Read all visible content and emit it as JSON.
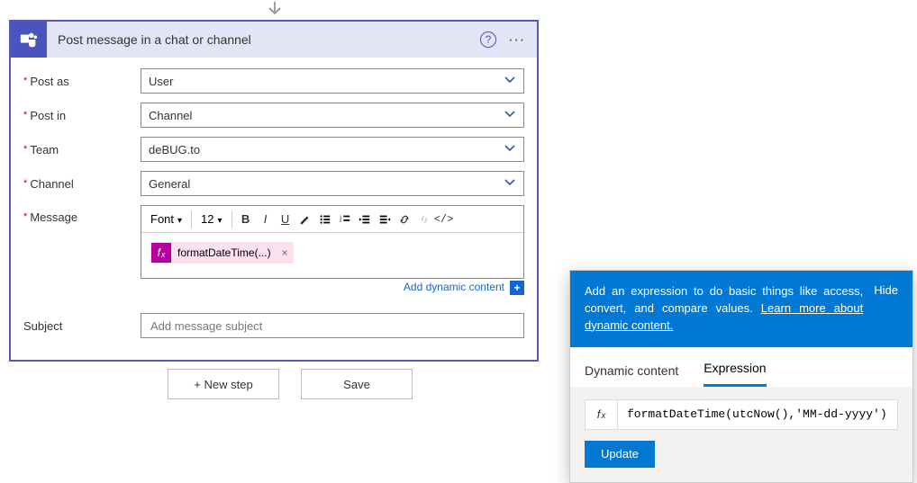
{
  "card": {
    "title": "Post message in a chat or channel",
    "fields": {
      "post_as": {
        "label": "Post as",
        "value": "User"
      },
      "post_in": {
        "label": "Post in",
        "value": "Channel"
      },
      "team": {
        "label": "Team",
        "value": "deBUG.to"
      },
      "channel": {
        "label": "Channel",
        "value": "General"
      },
      "message": {
        "label": "Message"
      },
      "subject": {
        "label": "Subject",
        "placeholder": "Add message subject"
      }
    },
    "toolbar": {
      "font_label": "Font",
      "size_label": "12"
    },
    "token": {
      "text": "formatDateTime(...)"
    },
    "add_dynamic_label": "Add dynamic content"
  },
  "footer": {
    "new_step": "+ New step",
    "save": "Save"
  },
  "panel": {
    "tip": "Add an expression to do basic things like access, convert, and compare values. ",
    "learn_more": "Learn more about dynamic content.",
    "hide": "Hide",
    "tabs": {
      "dynamic": "Dynamic content",
      "expression": "Expression"
    },
    "expression_value": "formatDateTime(utcNow(),'MM-dd-yyyy')",
    "update": "Update"
  }
}
